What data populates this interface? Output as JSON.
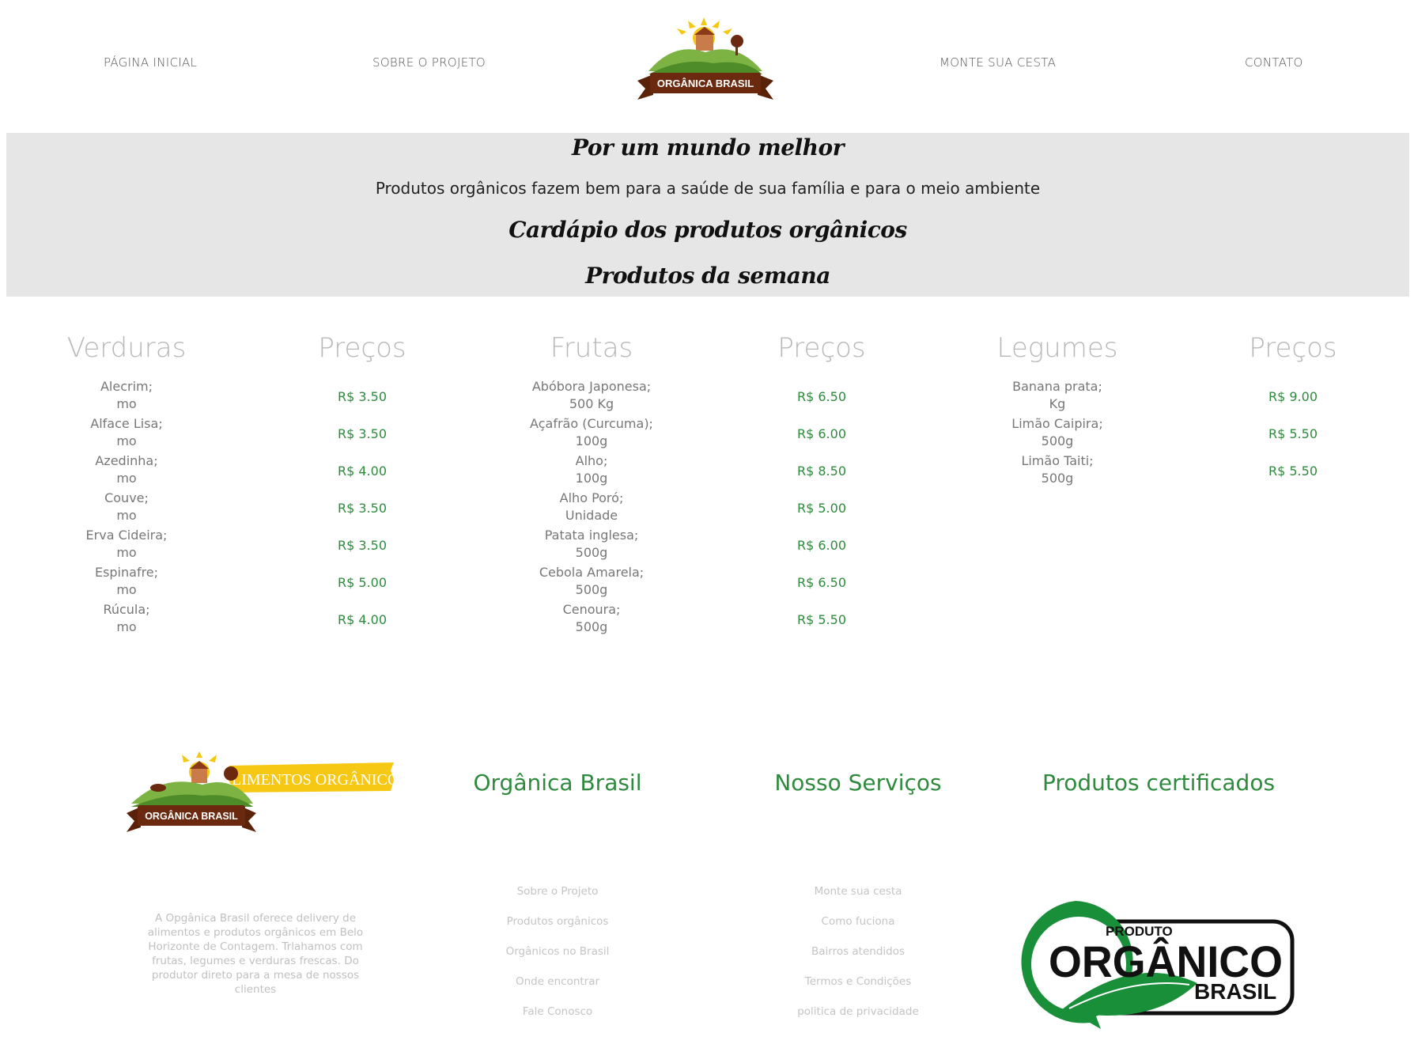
{
  "nav": {
    "links": [
      "PÁGINA INICIAL",
      "SOBRE O PROJETO",
      "MONTE SUA CESTA",
      "CONTATO"
    ],
    "logo_text": "ORGÂNICA BRASIL"
  },
  "hero": {
    "title": "Por um mundo melhor",
    "subtitle": "Produtos orgânicos fazem bem para a saúde de sua família e para o meio ambiente",
    "menu_title": "Cardápio dos produtos orgânicos",
    "week_title": "Produtos da semana"
  },
  "menu": {
    "verduras": {
      "heading": "Verduras",
      "price_heading": "Preços",
      "items": [
        {
          "name": "Alecrim;",
          "unit": "mo",
          "price": "R$ 3.50"
        },
        {
          "name": "Alface Lisa;",
          "unit": "mo",
          "price": "R$ 3.50"
        },
        {
          "name": "Azedinha;",
          "unit": "mo",
          "price": "R$ 4.00"
        },
        {
          "name": "Couve;",
          "unit": "mo",
          "price": "R$ 3.50"
        },
        {
          "name": "Erva Cideira;",
          "unit": "mo",
          "price": "R$ 3.50"
        },
        {
          "name": "Espinafre;",
          "unit": "mo",
          "price": "R$ 5.00"
        },
        {
          "name": "Rúcula;",
          "unit": "mo",
          "price": "R$ 4.00"
        }
      ]
    },
    "frutas": {
      "heading": "Frutas",
      "price_heading": "Preços",
      "items": [
        {
          "name": "Abóbora Japonesa;",
          "unit": "500 Kg",
          "price": "R$ 6.50"
        },
        {
          "name": "Açafrão (Curcuma);",
          "unit": "100g",
          "price": "R$ 6.00"
        },
        {
          "name": "Alho;",
          "unit": "100g",
          "price": "R$ 8.50"
        },
        {
          "name": "Alho Poró;",
          "unit": "Unidade",
          "price": "R$ 5.00"
        },
        {
          "name": "Patata inglesa;",
          "unit": "500g",
          "price": "R$ 6.00"
        },
        {
          "name": "Cebola Amarela;",
          "unit": "500g",
          "price": "R$ 6.50"
        },
        {
          "name": "Cenoura;",
          "unit": "500g",
          "price": "R$ 5.50"
        }
      ]
    },
    "legumes": {
      "heading": "Legumes",
      "price_heading": "Preços",
      "items": [
        {
          "name": "Banana prata;",
          "unit": "Kg",
          "price": "R$ 9.00"
        },
        {
          "name": "Limão Caipira;",
          "unit": "500g",
          "price": "R$ 5.50"
        },
        {
          "name": "Limão Taiti;",
          "unit": "500g",
          "price": "R$ 5.50"
        }
      ]
    }
  },
  "footer": {
    "logo_text": "ORGÂNICA BRASIL",
    "logo_banner": "ALIMENTOS ORGÂNICOS",
    "about": "A Opgânica Brasil oferece delivery de alimentos e produtos orgânicos em Belo Horizonte de Contagem. Trlahamos com frutas, legumes e verduras frescas. Do produtor direto para a mesa de nossos clientes",
    "col1_heading": "Orgânica Brasil",
    "col1_links": [
      "Sobre o Projeto",
      "Produtos orgânicos",
      "Orgânicos no Brasil",
      "Onde encontrar",
      "Fale Conosco"
    ],
    "col2_heading": "Nosso Serviços",
    "col2_links": [
      "Monte sua cesta",
      "Como fuciona",
      "Bairros atendidos",
      "Termos e Condições",
      "politica de privacidade"
    ],
    "col3_heading": "Produtos certificados",
    "seal_top": "PRODUTO",
    "seal_main": "ORGÂNICO",
    "seal_bottom": "BRASIL"
  },
  "colors": {
    "accent_green": "#2e8b3d",
    "hero_bg": "#e6e6e6",
    "logo_brown": "#6b2a0f",
    "banner_yellow": "#f6c814"
  }
}
